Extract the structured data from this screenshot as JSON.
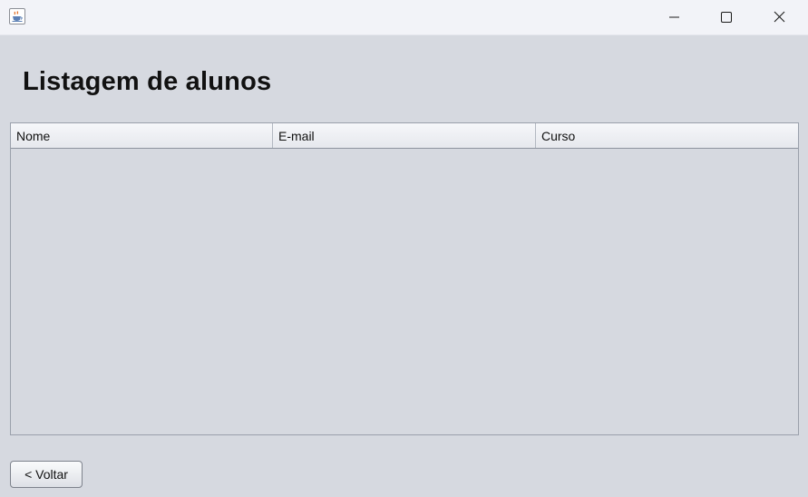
{
  "window": {
    "title": "",
    "controls": {
      "minimize_icon": "minimize-icon",
      "maximize_icon": "maximize-icon",
      "close_icon": "close-icon"
    },
    "app_icon": "java-coffee-cup-icon"
  },
  "page": {
    "title": "Listagem de alunos"
  },
  "table": {
    "columns": [
      "Nome",
      "E-mail",
      "Curso"
    ],
    "rows": []
  },
  "footer": {
    "back_label": "< Voltar"
  },
  "colors": {
    "background": "#d6d9e0",
    "titlebar": "#f2f3f8",
    "text": "#111111",
    "border": "#9aa0ab"
  }
}
